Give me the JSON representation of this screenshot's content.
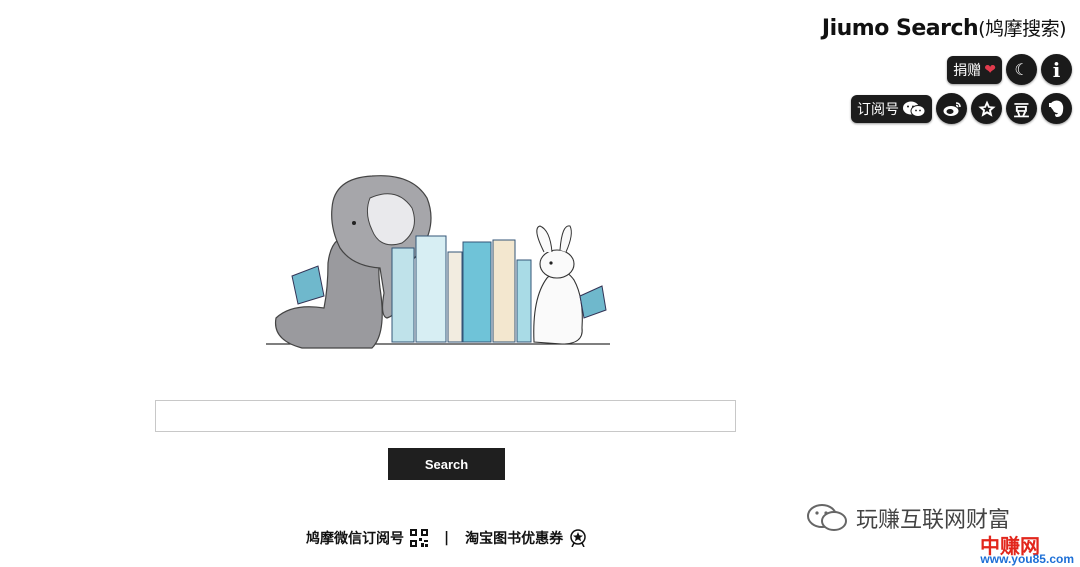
{
  "header": {
    "brand": "Jiumo Search",
    "brand_sub": "(鸠摩搜索)",
    "donate_label": "捐赠",
    "subscribe_label": "订阅号",
    "douban_label": "豆"
  },
  "search": {
    "value": "",
    "button_label": "Search"
  },
  "footer": {
    "wechat_link": "鸠摩微信订阅号",
    "separator": "|",
    "taobao_link": "淘宝图书优惠券"
  },
  "watermark": {
    "text": "玩赚互联网财富",
    "logo": "中赚网",
    "url": "www.you85.com"
  },
  "colors": {
    "dark": "#1c1c1c",
    "heart": "#e23b4d",
    "book_blue": "#7fc6d6",
    "watermark_red": "#e2261c",
    "watermark_blue": "#1d6fd6"
  }
}
